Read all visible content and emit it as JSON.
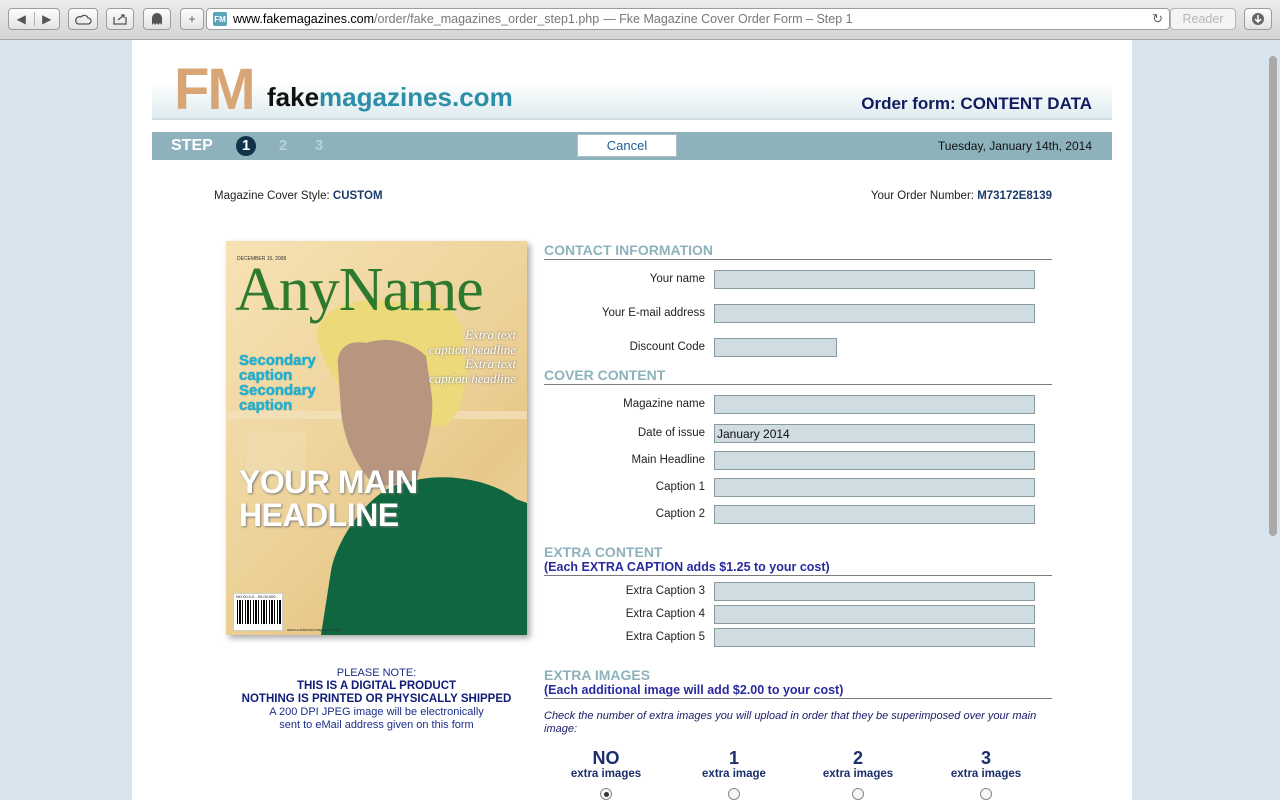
{
  "browser": {
    "url_host": "www.fakemagazines.com",
    "url_path": "/order/fake_magazines_order_step1.php",
    "page_title": "— Fke Magazine Cover Order Form – Step 1",
    "reader_label": "Reader",
    "favicon_text": "FM"
  },
  "header": {
    "logo_fm": "FM",
    "logo_fake": "fake",
    "logo_magazines": "magazines",
    "logo_dotcom": ".com",
    "order_title": "Order form: CONTENT DATA"
  },
  "stepbar": {
    "label": "STEP",
    "steps": [
      "1",
      "2",
      "3"
    ],
    "active_step": "1",
    "cancel_label": "Cancel",
    "date": "Tuesday, January 14th, 2014"
  },
  "info": {
    "style_label": "Magazine Cover Style:",
    "style_value": "CUSTOM",
    "order_label": "Your Order Number:",
    "order_value": "M73172E8139"
  },
  "cover": {
    "date": "DECEMBER 15, 2008",
    "title": "AnyName",
    "secondary": "Secondary caption Secondary caption",
    "extra": "Extra text caption headline Extra text caption headline",
    "headline": "YOUR MAIN HEADLINE",
    "barcode_text": "NO 00.0.0 - 00.00.000",
    "site": "www.customizemagazine.com",
    "colors": {
      "title": "#2d7a2e",
      "secondary": "#18b3d9",
      "shirt": "#10673f",
      "face": "#b8957f",
      "hair": "#ecd97a"
    }
  },
  "note": {
    "line1": "PLEASE NOTE:",
    "line2": "THIS IS A DIGITAL PRODUCT",
    "line3": "NOTHING IS PRINTED OR PHYSICALLY SHIPPED",
    "line4": "A 200 DPI JPEG image will be electronically",
    "line5": "sent to eMail address given on this form"
  },
  "form": {
    "contact": {
      "title": "CONTACT INFORMATION",
      "fields": [
        {
          "label": "Your name",
          "value": ""
        },
        {
          "label": "Your E-mail address",
          "value": ""
        },
        {
          "label": "Discount Code",
          "value": ""
        }
      ]
    },
    "cover": {
      "title": "COVER CONTENT",
      "fields": [
        {
          "label": "Magazine name",
          "value": ""
        },
        {
          "label": "Date of issue",
          "value": "January 2014"
        },
        {
          "label": "Main Headline",
          "value": ""
        },
        {
          "label": "Caption 1",
          "value": ""
        },
        {
          "label": "Caption 2",
          "value": ""
        }
      ]
    },
    "extra": {
      "title": "EXTRA CONTENT",
      "subtitle": "(Each EXTRA CAPTION adds $1.25 to your cost)",
      "fields": [
        {
          "label": "Extra Caption 3",
          "value": ""
        },
        {
          "label": "Extra Caption 4",
          "value": ""
        },
        {
          "label": "Extra Caption 5",
          "value": ""
        }
      ]
    },
    "images": {
      "title": "EXTRA IMAGES",
      "subtitle": "(Each additional image will add $2.00 to your cost)",
      "instructions": "Check the number of extra images you will upload in order that they be superimposed over your main image:",
      "options": [
        {
          "n": "NO",
          "t": "extra images",
          "selected": true
        },
        {
          "n": "1",
          "t": "extra image",
          "selected": false
        },
        {
          "n": "2",
          "t": "extra images",
          "selected": false
        },
        {
          "n": "3",
          "t": "extra images",
          "selected": false
        }
      ]
    }
  }
}
